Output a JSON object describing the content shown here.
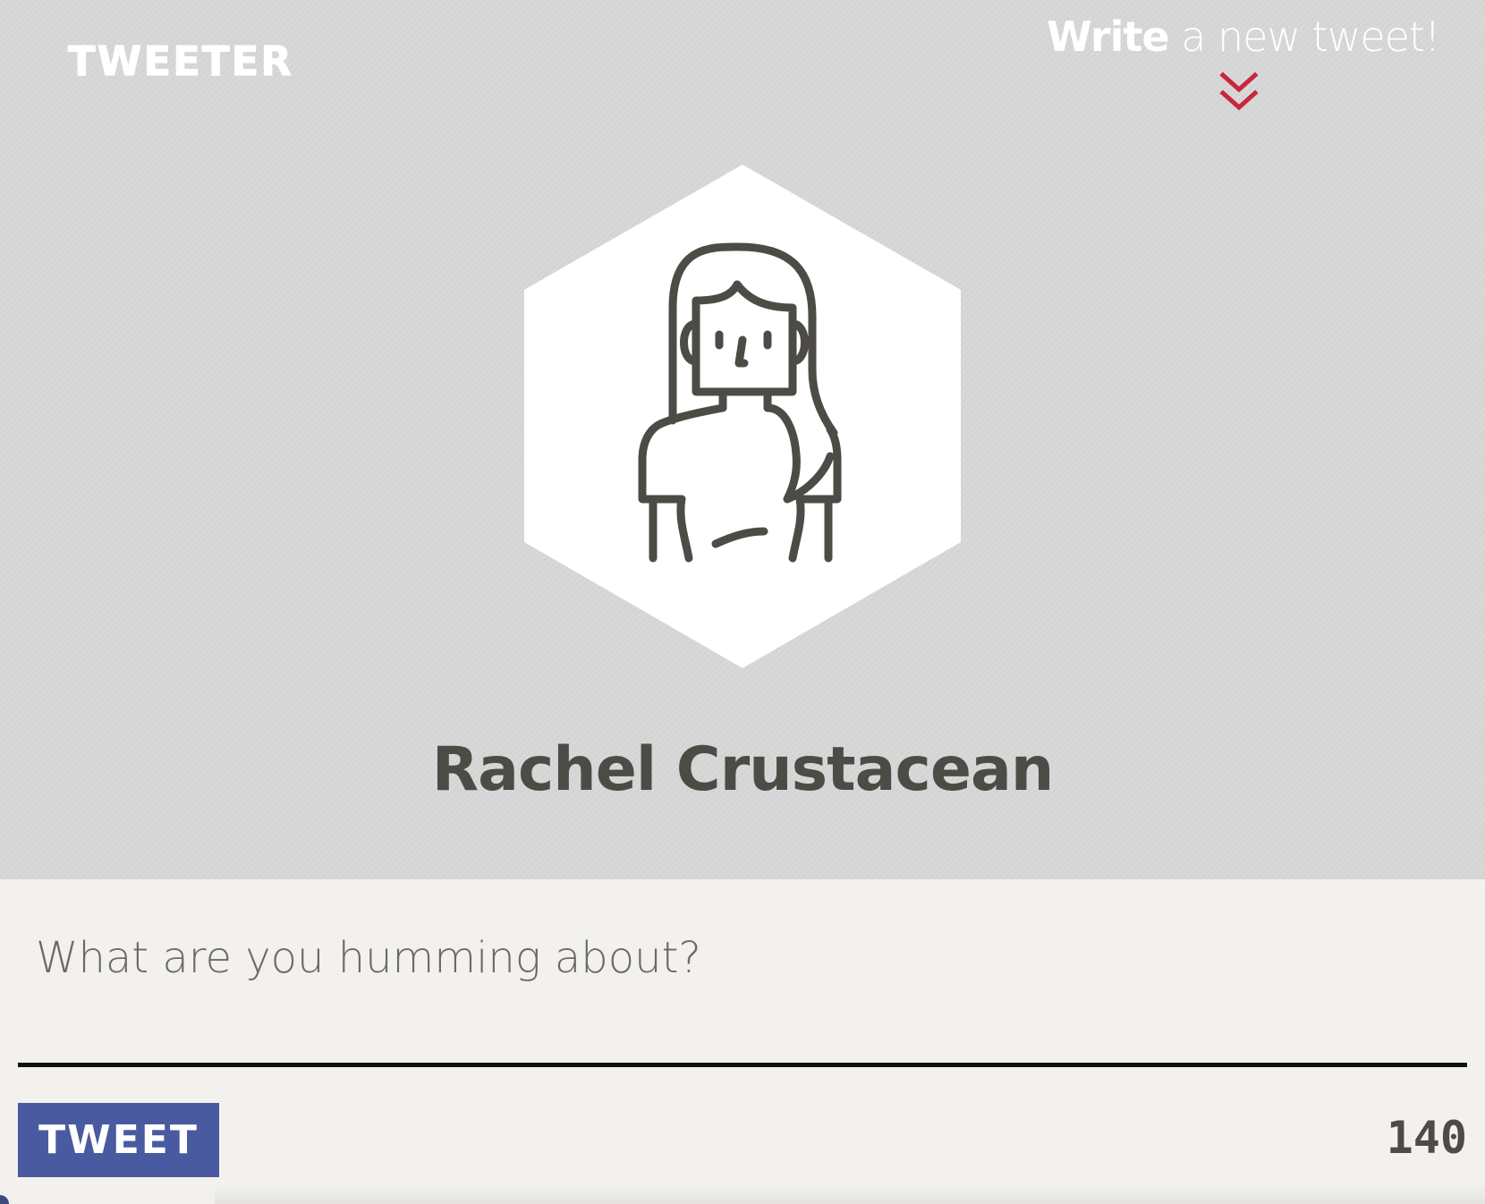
{
  "header": {
    "logo": "TWEETER",
    "write_prompt_strong": "Write",
    "write_prompt_rest": " a new tweet!",
    "chevron_icon": "double-chevron-down-icon",
    "chevron_color": "#c8273b"
  },
  "profile": {
    "avatar_icon": "woman-avatar-icon",
    "name": "Rachel Crustacean"
  },
  "composer": {
    "placeholder": "What are you humming about?",
    "value": "",
    "submit_label": "TWEET",
    "char_count": "140"
  },
  "colors": {
    "hero_background": "#d7d7d7",
    "composer_background": "#f2f1ed",
    "button_background": "#4a5aa0",
    "text_dark": "#4d4b46",
    "accent_red": "#c8273b"
  }
}
